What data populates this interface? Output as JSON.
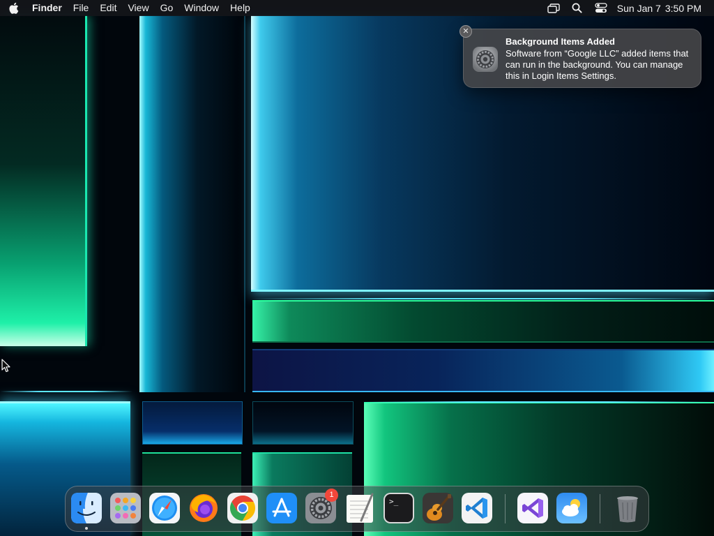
{
  "menubar": {
    "apple_icon": "apple-icon",
    "app_name": "Finder",
    "menus": [
      "File",
      "Edit",
      "View",
      "Go",
      "Window",
      "Help"
    ],
    "status_icons": [
      "screen-mirroring-icon",
      "spotlight-search-icon",
      "control-center-icon"
    ],
    "date": "Sun Jan 7",
    "time": "3:50 PM"
  },
  "notification": {
    "icon": "system-settings-gear-icon",
    "title": "Background Items Added",
    "body": "Software from “Google LLC” added items that can run in the background. You can manage this in Login Items Settings.",
    "close_icon": "close-icon"
  },
  "dock": {
    "apps": [
      {
        "icon": "finder-icon",
        "running": true
      },
      {
        "icon": "launchpad-icon"
      },
      {
        "icon": "safari-icon"
      },
      {
        "icon": "firefox-icon"
      },
      {
        "icon": "chrome-icon"
      },
      {
        "icon": "app-store-icon"
      },
      {
        "icon": "system-settings-icon",
        "badge": "1"
      },
      {
        "icon": "textedit-icon"
      },
      {
        "icon": "terminal-icon",
        "prompt": ">_"
      },
      {
        "icon": "garageband-icon"
      },
      {
        "icon": "vscode-icon"
      }
    ],
    "recent": [
      {
        "icon": "visual-studio-icon"
      },
      {
        "icon": "weather-icon"
      }
    ],
    "trash": {
      "icon": "trash-icon"
    }
  },
  "colors": {
    "badge": "#f2473a",
    "notification_bg": "#48484a",
    "menubar_bg": "#14161a",
    "accent_cyan": "#5ce8ff",
    "accent_green": "#2aff9e"
  }
}
